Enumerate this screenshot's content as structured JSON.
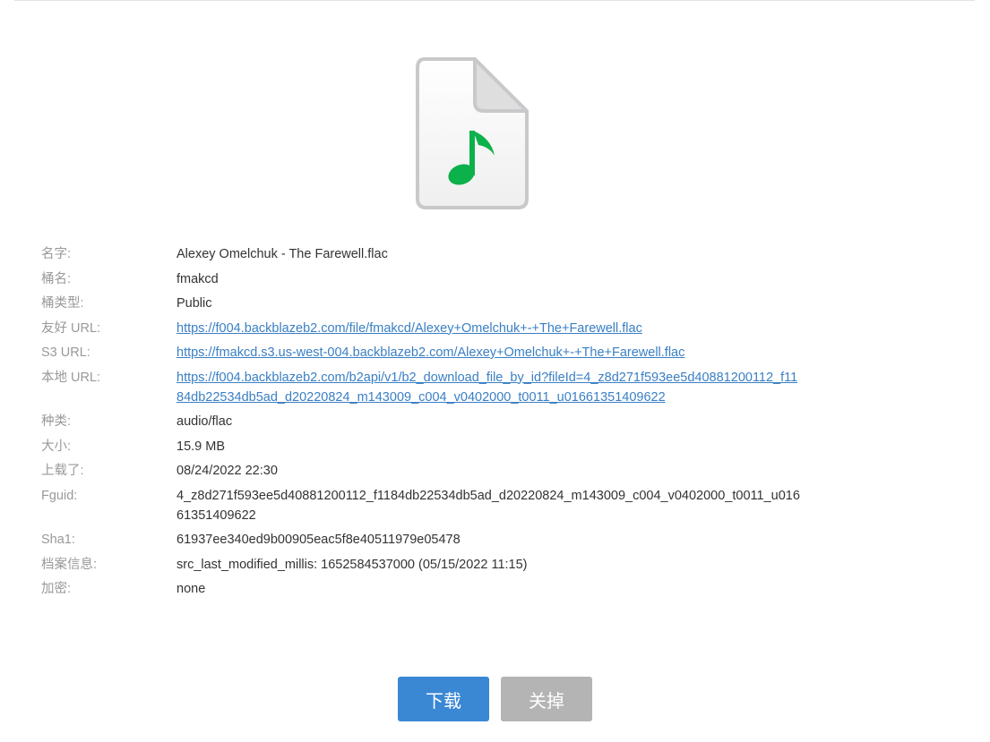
{
  "file_icon": {
    "icon": "audio-file-icon",
    "note_color": "#0db14b"
  },
  "details": [
    {
      "key": "name",
      "label": "名字:",
      "value": "Alexey Omelchuk - The Farewell.flac",
      "type": "text"
    },
    {
      "key": "bucket_name",
      "label": "桶名:",
      "value": "fmakcd",
      "type": "text"
    },
    {
      "key": "bucket_type",
      "label": "桶类型:",
      "value": "Public",
      "type": "text"
    },
    {
      "key": "friendly_url",
      "label": "友好 URL:",
      "value": "https://f004.backblazeb2.com/file/fmakcd/Alexey+Omelchuk+-+The+Farewell.flac",
      "type": "link"
    },
    {
      "key": "s3_url",
      "label": "S3 URL:",
      "value": "https://fmakcd.s3.us-west-004.backblazeb2.com/Alexey+Omelchuk+-+The+Farewell.flac",
      "type": "link-underline"
    },
    {
      "key": "native_url",
      "label": "本地 URL:",
      "value": "https://f004.backblazeb2.com/b2api/v1/b2_download_file_by_id?fileId=4_z8d271f593ee5d40881200112_f1184db22534db5ad_d20220824_m143009_c004_v0402000_t0011_u01661351409622",
      "type": "link"
    },
    {
      "key": "kind",
      "label": "种类:",
      "value": "audio/flac",
      "type": "text"
    },
    {
      "key": "size",
      "label": "大小:",
      "value": "15.9 MB",
      "type": "text"
    },
    {
      "key": "uploaded",
      "label": "上载了:",
      "value": "08/24/2022 22:30",
      "type": "text"
    },
    {
      "key": "fguid",
      "label": "Fguid:",
      "value": "4_z8d271f593ee5d40881200112_f1184db22534db5ad_d20220824_m143009_c004_v0402000_t0011_u01661351409622",
      "type": "text"
    },
    {
      "key": "sha1",
      "label": "Sha1:",
      "value": "61937ee340ed9b00905eac5f8e40511979e05478",
      "type": "text"
    },
    {
      "key": "file_info",
      "label": "档案信息:",
      "value": "src_last_modified_millis: 1652584537000   (05/15/2022 11:15)",
      "type": "text"
    },
    {
      "key": "encryption",
      "label": "加密:",
      "value": "none",
      "type": "text"
    }
  ],
  "buttons": {
    "download_label": "下载",
    "download_color": "#3a87d4",
    "close_label": "关掉",
    "close_color": "#b4b4b4"
  }
}
